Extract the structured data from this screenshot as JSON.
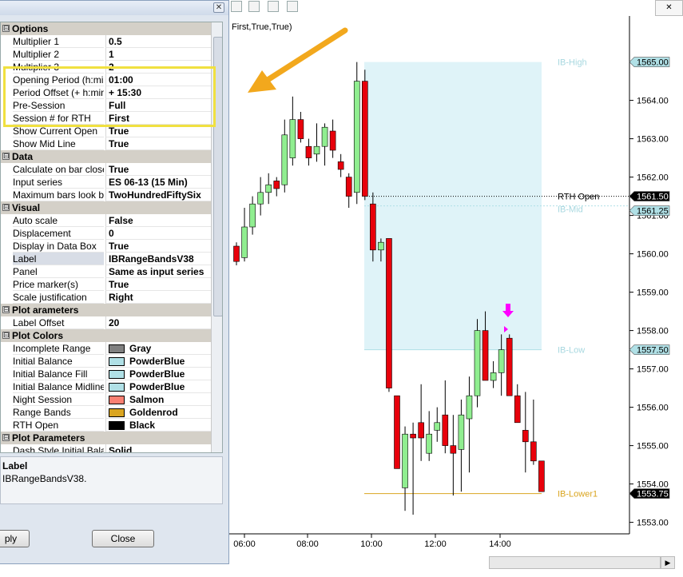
{
  "chart": {
    "indicator_args": "First,True,True)",
    "time_labels": [
      "06:00",
      "08:00",
      "10:00",
      "12:00",
      "14:00"
    ],
    "price_ticks": [
      "1565.00",
      "1564.00",
      "1563.00",
      "1562.00",
      "1561.00",
      "1560.00",
      "1559.00",
      "1558.00",
      "1557.00",
      "1556.00",
      "1555.00",
      "1554.00",
      "1553.00"
    ],
    "price_tick_values": [
      1565,
      1564,
      1563,
      1562,
      1561,
      1560,
      1559,
      1558,
      1557,
      1556,
      1555,
      1554,
      1553
    ],
    "level_labels": {
      "ib_high": "IB-High",
      "rth_open": "RTH Open",
      "ib_mid": "IB-Mid",
      "ib_low": "IB-Low",
      "ib_lower1": "IB-Lower1"
    },
    "level_values": {
      "ib_high": 1565.0,
      "rth_open": 1561.5,
      "ib_mid": 1561.25,
      "ib_low": 1557.5,
      "ib_lower1": 1553.75
    },
    "price_markers": [
      "1565.00",
      "1561.50",
      "1561.25",
      "1557.50",
      "1553.75"
    ],
    "colors": {
      "up": "#90ee90",
      "down": "#e8000b",
      "ib_fill": "#dff3f8",
      "ib_line": "#b0e0e6",
      "lower": "#daa520",
      "marker": "#ff00ff"
    }
  },
  "chart_data": {
    "type": "candlestick",
    "ylim": [
      1552.7,
      1566.2
    ],
    "candles": [
      {
        "o": 1560.2,
        "h": 1560.3,
        "l": 1559.7,
        "c": 1559.8
      },
      {
        "o": 1559.9,
        "h": 1561.2,
        "l": 1559.8,
        "c": 1560.7
      },
      {
        "o": 1560.7,
        "h": 1561.5,
        "l": 1560.5,
        "c": 1561.3
      },
      {
        "o": 1561.3,
        "h": 1562.0,
        "l": 1561.0,
        "c": 1561.6
      },
      {
        "o": 1561.6,
        "h": 1562.1,
        "l": 1561.3,
        "c": 1561.8
      },
      {
        "o": 1561.9,
        "h": 1562.0,
        "l": 1561.5,
        "c": 1561.7
      },
      {
        "o": 1561.8,
        "h": 1563.5,
        "l": 1561.6,
        "c": 1563.1
      },
      {
        "o": 1562.5,
        "h": 1564.1,
        "l": 1562.3,
        "c": 1563.5
      },
      {
        "o": 1563.5,
        "h": 1563.7,
        "l": 1562.9,
        "c": 1563.0
      },
      {
        "o": 1562.8,
        "h": 1563.0,
        "l": 1562.3,
        "c": 1562.5
      },
      {
        "o": 1562.6,
        "h": 1563.4,
        "l": 1562.4,
        "c": 1562.8
      },
      {
        "o": 1562.8,
        "h": 1563.4,
        "l": 1562.3,
        "c": 1563.3
      },
      {
        "o": 1563.2,
        "h": 1563.5,
        "l": 1562.5,
        "c": 1562.7
      },
      {
        "o": 1562.4,
        "h": 1562.6,
        "l": 1562.0,
        "c": 1562.2
      },
      {
        "o": 1562.0,
        "h": 1562.1,
        "l": 1561.2,
        "c": 1561.5
      },
      {
        "o": 1561.6,
        "h": 1565.0,
        "l": 1561.3,
        "c": 1564.5
      },
      {
        "o": 1564.5,
        "h": 1564.8,
        "l": 1561.4,
        "c": 1561.5
      },
      {
        "o": 1561.3,
        "h": 1561.6,
        "l": 1559.8,
        "c": 1560.1
      },
      {
        "o": 1560.1,
        "h": 1560.4,
        "l": 1559.8,
        "c": 1560.3
      },
      {
        "o": 1560.4,
        "h": 1560.4,
        "l": 1556.4,
        "c": 1556.5
      },
      {
        "o": 1556.3,
        "h": 1556.3,
        "l": 1555.8,
        "c": 1554.4
      },
      {
        "o": 1553.9,
        "h": 1555.5,
        "l": 1553.3,
        "c": 1555.3
      },
      {
        "o": 1555.3,
        "h": 1555.6,
        "l": 1553.2,
        "c": 1555.2
      },
      {
        "o": 1555.6,
        "h": 1556.6,
        "l": 1554.6,
        "c": 1555.2
      },
      {
        "o": 1554.8,
        "h": 1555.9,
        "l": 1554.6,
        "c": 1555.3
      },
      {
        "o": 1555.4,
        "h": 1556.0,
        "l": 1555.1,
        "c": 1555.6
      },
      {
        "o": 1555.8,
        "h": 1556.7,
        "l": 1554.8,
        "c": 1555.0
      },
      {
        "o": 1555.0,
        "h": 1555.8,
        "l": 1553.7,
        "c": 1554.8
      },
      {
        "o": 1554.9,
        "h": 1556.2,
        "l": 1553.8,
        "c": 1555.8
      },
      {
        "o": 1555.7,
        "h": 1556.8,
        "l": 1554.3,
        "c": 1556.3
      },
      {
        "o": 1556.3,
        "h": 1558.3,
        "l": 1556.0,
        "c": 1558.0
      },
      {
        "o": 1558.0,
        "h": 1558.5,
        "l": 1556.7,
        "c": 1556.7
      },
      {
        "o": 1556.7,
        "h": 1557.2,
        "l": 1556.5,
        "c": 1556.9
      },
      {
        "o": 1556.9,
        "h": 1557.9,
        "l": 1556.3,
        "c": 1557.5
      },
      {
        "o": 1557.8,
        "h": 1557.9,
        "l": 1556.3,
        "c": 1556.3
      },
      {
        "o": 1556.3,
        "h": 1556.6,
        "l": 1555.6,
        "c": 1555.6
      },
      {
        "o": 1555.4,
        "h": 1556.4,
        "l": 1554.3,
        "c": 1555.1
      },
      {
        "o": 1555.1,
        "h": 1556.2,
        "l": 1554.5,
        "c": 1554.6
      },
      {
        "o": 1554.6,
        "h": 1554.6,
        "l": 1553.8,
        "c": 1553.8
      }
    ]
  },
  "dialog": {
    "categories": [
      {
        "name": "Options",
        "rows": [
          {
            "name": "Multiplier 1",
            "value": "0.5"
          },
          {
            "name": "Multiplier 2",
            "value": "1"
          },
          {
            "name": "Multiplier 3",
            "value": "2"
          },
          {
            "name": "Opening Period (h:min)",
            "value": "01:00"
          },
          {
            "name": "Period Offset (+ h:min)",
            "value": "+ 15:30"
          },
          {
            "name": "Pre-Session",
            "value": "Full"
          },
          {
            "name": "Session # for RTH",
            "value": "First"
          },
          {
            "name": "Show Current Open",
            "value": "True"
          },
          {
            "name": "Show Mid Line",
            "value": "True"
          }
        ]
      },
      {
        "name": "Data",
        "rows": [
          {
            "name": "Calculate on bar close",
            "value": "True"
          },
          {
            "name": "Input series",
            "value": "ES 06-13 (15 Min)"
          },
          {
            "name": "Maximum bars look back",
            "value": "TwoHundredFiftySix"
          }
        ]
      },
      {
        "name": "Visual",
        "rows": [
          {
            "name": "Auto scale",
            "value": "False"
          },
          {
            "name": "Displacement",
            "value": "0"
          },
          {
            "name": "Display in Data Box",
            "value": "True"
          },
          {
            "name": "Label",
            "value": "IBRangeBandsV38"
          },
          {
            "name": "Panel",
            "value": "Same as input series"
          },
          {
            "name": "Price marker(s)",
            "value": "True"
          },
          {
            "name": "Scale justification",
            "value": "Right"
          }
        ]
      },
      {
        "name": "Plot arameters",
        "rows": [
          {
            "name": "Label Offset",
            "value": "20"
          }
        ]
      },
      {
        "name": "Plot Colors",
        "rows": [
          {
            "name": "Incomplete Range",
            "value": "Gray",
            "swatch": "#808080"
          },
          {
            "name": "Initial Balance",
            "value": "PowderBlue",
            "swatch": "#b0e0e6"
          },
          {
            "name": "Initial Balance Fill",
            "value": "PowderBlue",
            "swatch": "#b0e0e6"
          },
          {
            "name": "Initial Balance Midline",
            "value": "PowderBlue",
            "swatch": "#b0e0e6"
          },
          {
            "name": "Night Session",
            "value": "Salmon",
            "swatch": "#fa8072"
          },
          {
            "name": "Range Bands",
            "value": "Goldenrod",
            "swatch": "#daa520"
          },
          {
            "name": "RTH Open",
            "value": "Black",
            "swatch": "#000000"
          }
        ]
      },
      {
        "name": "Plot Parameters",
        "rows": [
          {
            "name": "Dash Style Initial Balance",
            "value": "Solid"
          }
        ]
      }
    ],
    "description_title": "Label",
    "description_text": "IBRangeBandsV38.",
    "apply_label": "ply",
    "close_label": "Close",
    "toggle_symbol": "⊟"
  }
}
